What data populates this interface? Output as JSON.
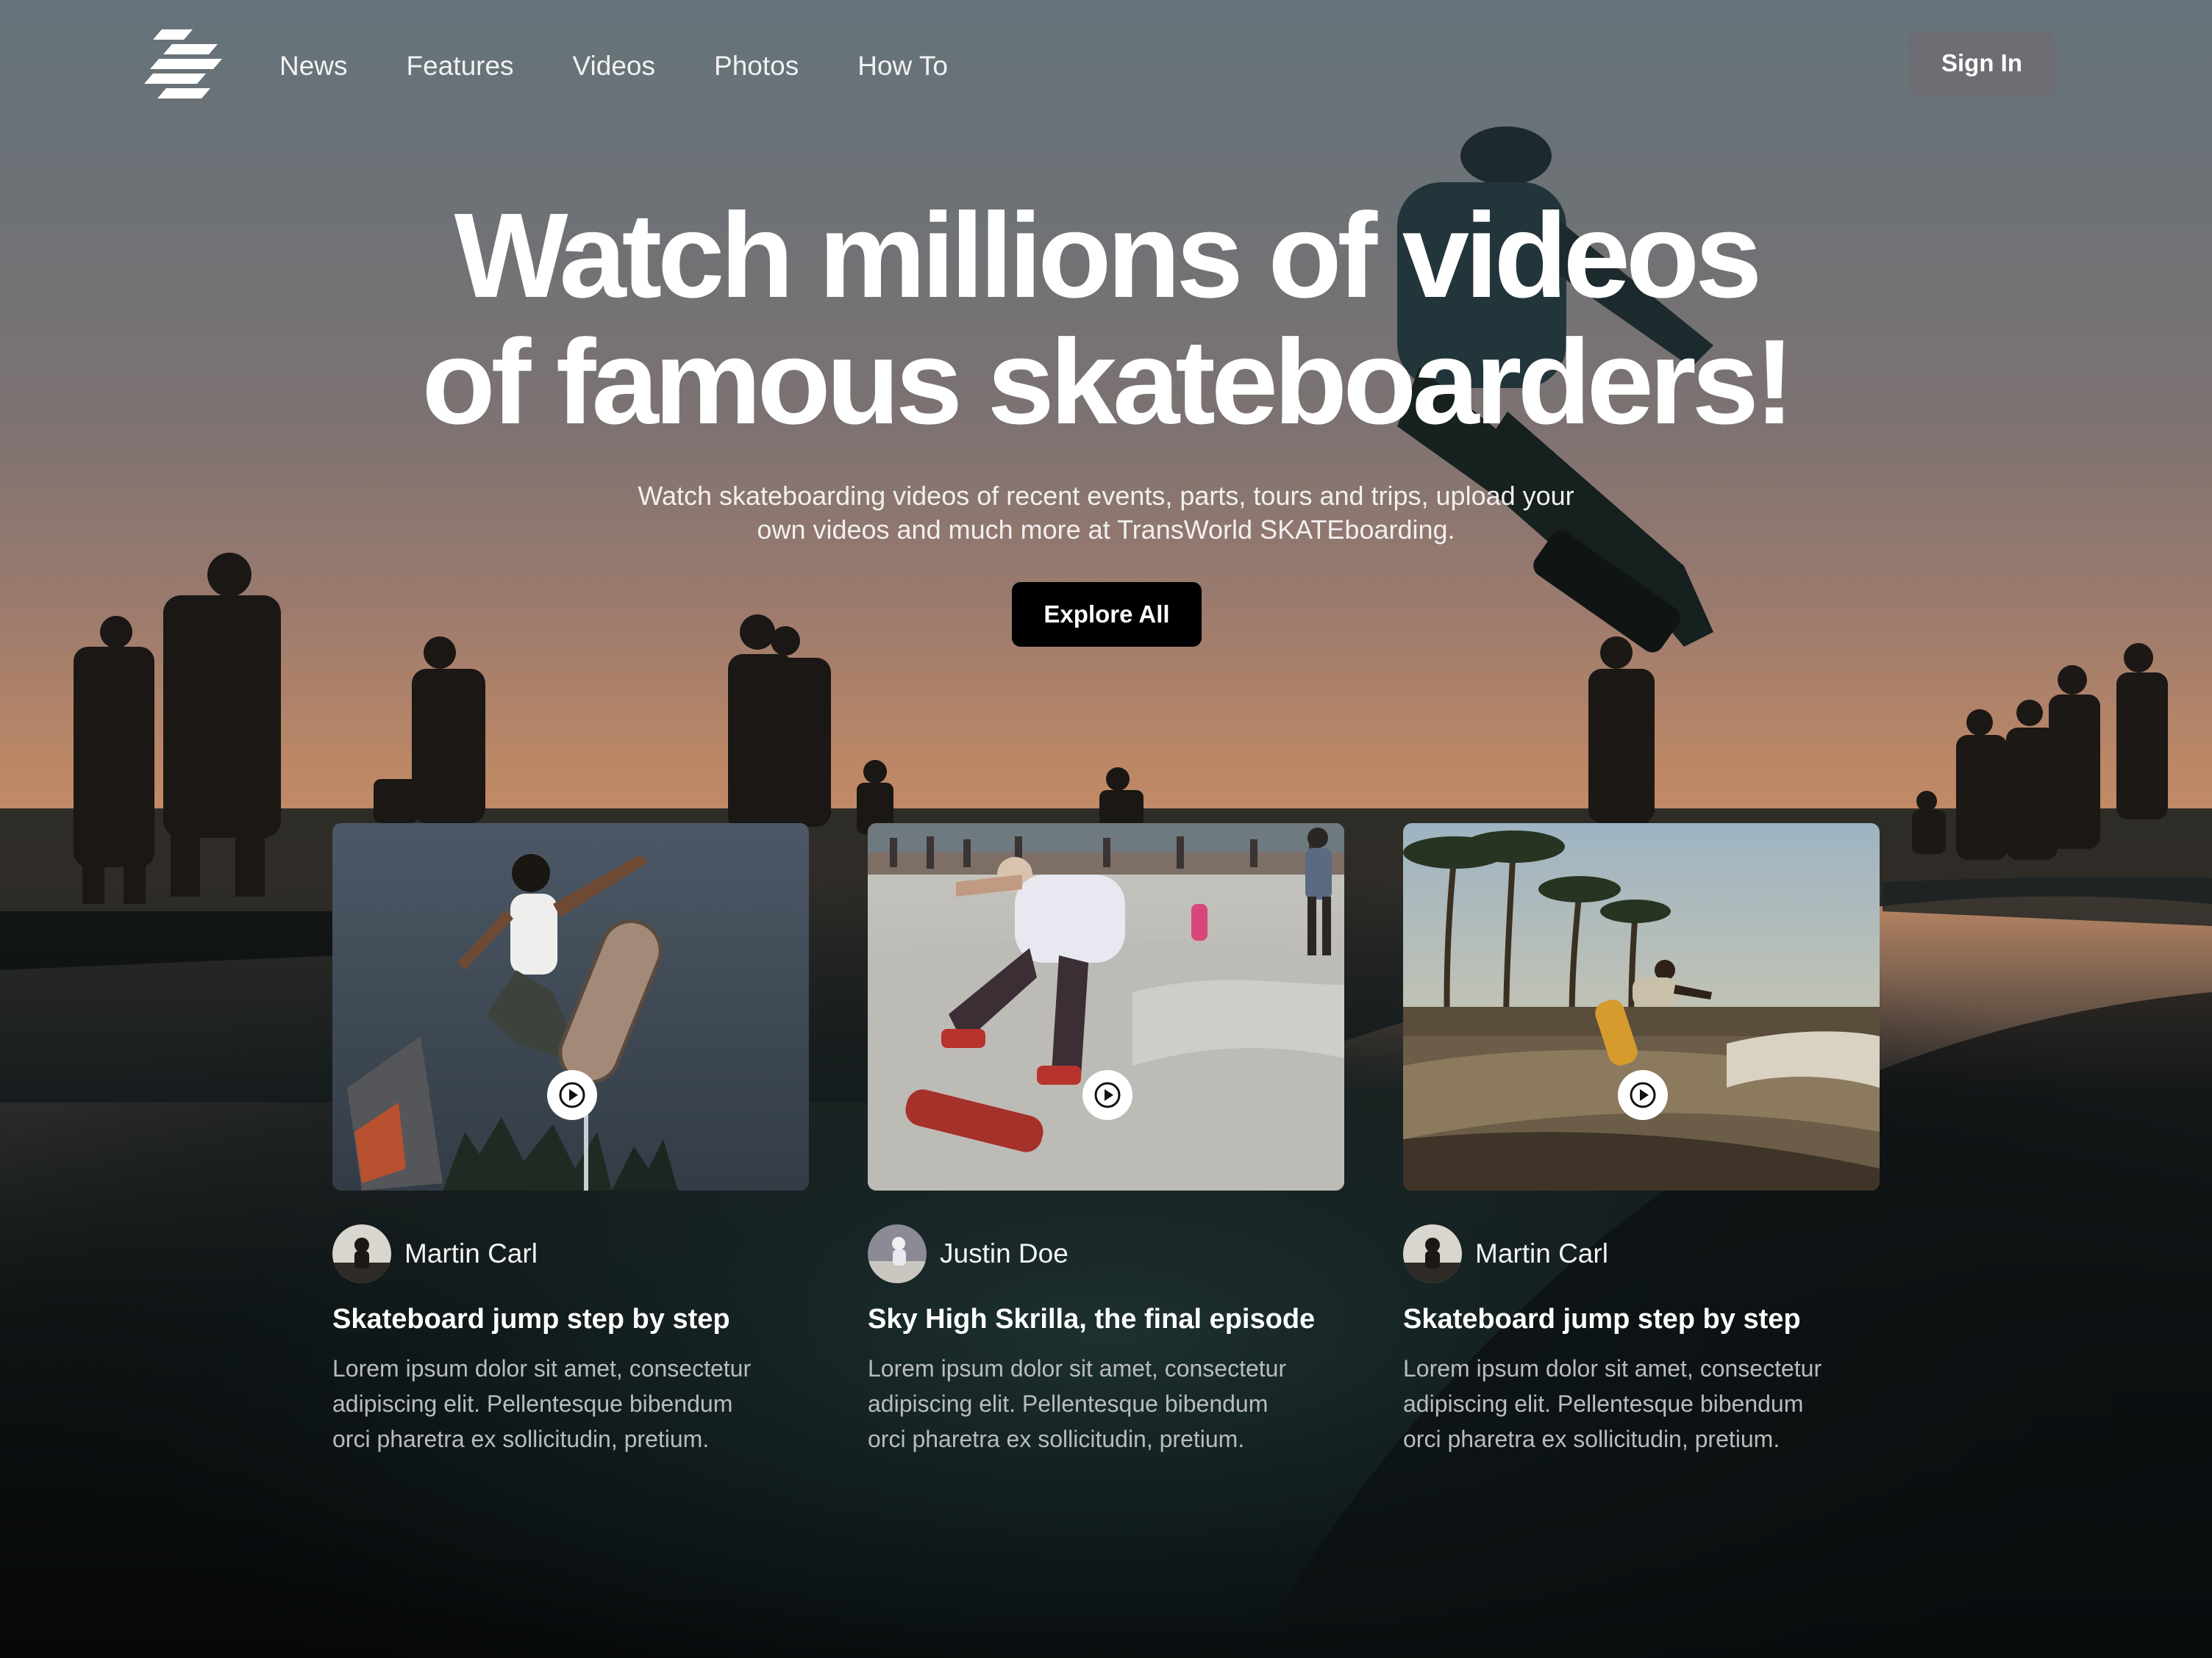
{
  "nav": {
    "items": [
      {
        "label": "News"
      },
      {
        "label": "Features"
      },
      {
        "label": "Videos"
      },
      {
        "label": "Photos"
      },
      {
        "label": "How To"
      }
    ],
    "sign_in_label": "Sign In"
  },
  "hero": {
    "title_lines": [
      "Watch millions of videos",
      "of famous skateboarders!"
    ],
    "subtitle_lines": [
      "Watch skateboarding videos of recent events, parts, tours and trips, upload your",
      "own videos and much more at TransWorld SKATEboarding."
    ],
    "cta_label": "Explore All"
  },
  "cards": [
    {
      "author": "Martin Carl",
      "title": "Skateboard jump step by step",
      "description_lines": [
        "Lorem ipsum dolor sit amet, consectetur",
        "adipiscing elit. Pellentesque bibendum",
        "orci pharetra ex sollicitudin, pretium."
      ]
    },
    {
      "author": "Justin Doe",
      "title": "Sky High Skrilla, the final episode",
      "description_lines": [
        "Lorem ipsum dolor sit amet, consectetur",
        "adipiscing elit. Pellentesque bibendum",
        "orci pharetra ex sollicitudin, pretium."
      ]
    },
    {
      "author": "Martin Carl",
      "title": "Skateboard jump step by step",
      "description_lines": [
        "Lorem ipsum dolor sit amet, consectetur",
        "adipiscing elit. Pellentesque bibendum",
        "orci pharetra ex sollicitudin, pretium."
      ]
    }
  ],
  "icons": {
    "logo": "stacked-stripes-logo-icon",
    "play": "play-icon"
  },
  "colors": {
    "sky_top": "#6a7378",
    "sky_sunset": "#c98a66",
    "ground_dark": "#07090a",
    "sign_in_bg": "#6e6c72",
    "cta_bg": "#000000"
  }
}
